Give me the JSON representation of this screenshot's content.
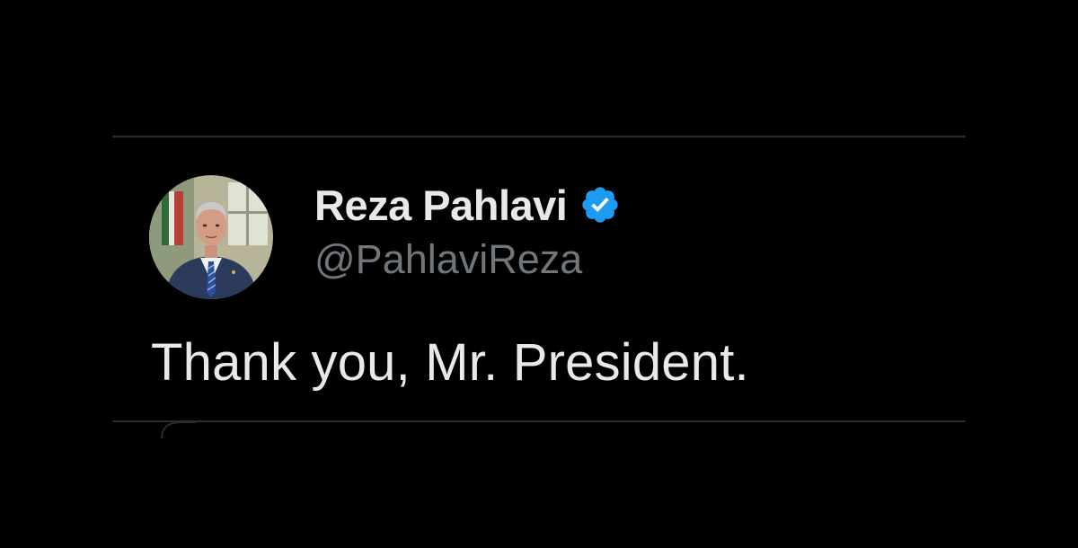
{
  "tweet": {
    "display_name": "Reza Pahlavi",
    "handle": "@PahlaviReza",
    "text": "Thank you, Mr. President.",
    "verified": true
  },
  "icons": {
    "verified": "verified-badge-icon",
    "avatar": "profile-photo"
  },
  "colors": {
    "background": "#000000",
    "primary_text": "#e7e9ea",
    "secondary_text": "#71767b",
    "verified_blue": "#1d9bf0",
    "divider": "#2a2c2f"
  }
}
